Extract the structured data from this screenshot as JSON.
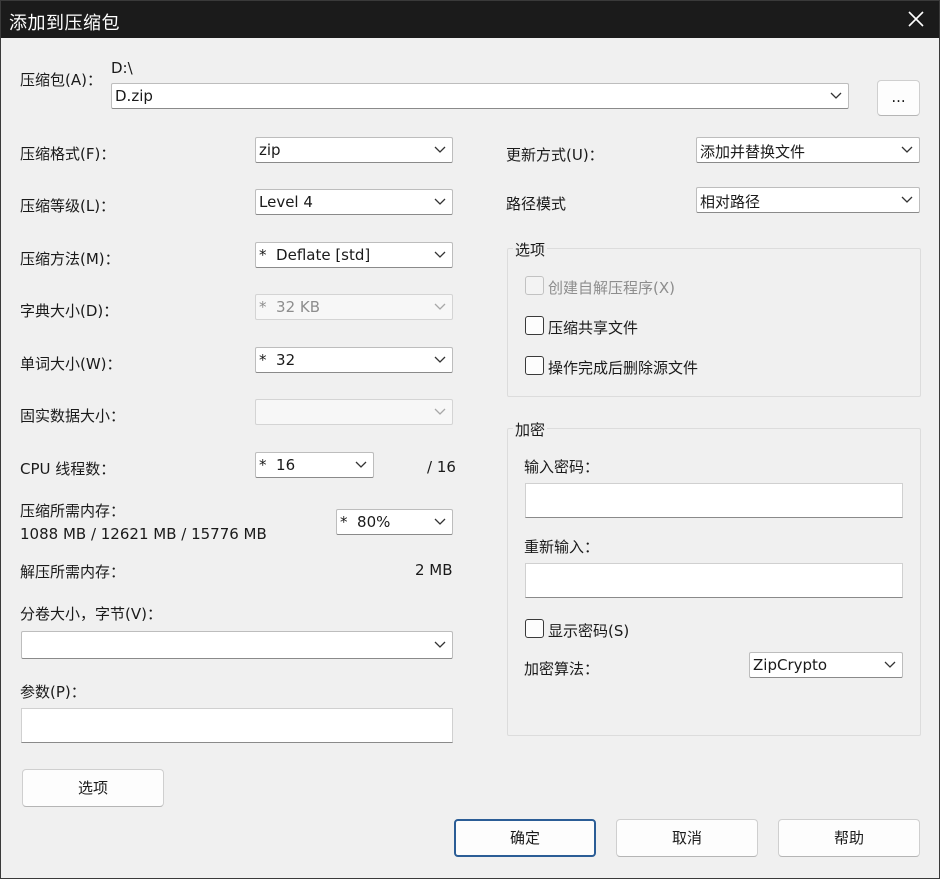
{
  "window": {
    "title": "添加到压缩包",
    "close_icon": "close-icon"
  },
  "archive": {
    "label": "压缩包(A)：",
    "path": "D:\\",
    "filename": "D.zip",
    "browse_label": "..."
  },
  "left": {
    "format": {
      "label": "压缩格式(F)：",
      "value": "zip"
    },
    "level": {
      "label": "压缩等级(L)：",
      "value": "Level 4"
    },
    "method": {
      "label": "压缩方法(M)：",
      "value": "*  Deflate [std]"
    },
    "dictionary": {
      "label": "字典大小(D)：",
      "value": "*  32 KB"
    },
    "word": {
      "label": "单词大小(W)：",
      "value": "*  32"
    },
    "solid": {
      "label": "固实数据大小：",
      "value": ""
    },
    "threads": {
      "label": "CPU 线程数：",
      "value": "*  16",
      "max": "/ 16"
    },
    "memory": {
      "label": "压缩所需内存：",
      "detail": "1088 MB / 12621 MB / 15776 MB",
      "value": "*  80%"
    },
    "decompress_memory": {
      "label": "解压所需内存：",
      "value": "2 MB"
    },
    "split": {
      "label": "分卷大小，字节(V)：",
      "value": ""
    },
    "params": {
      "label": "参数(P)：",
      "value": ""
    },
    "options_button": "选项"
  },
  "right": {
    "update": {
      "label": "更新方式(U)：",
      "value": "添加并替换文件"
    },
    "path_mode": {
      "label": "路径模式",
      "value": "相对路径"
    },
    "options": {
      "legend": "选项",
      "sfx": {
        "label": "创建自解压程序(X)",
        "checked": false,
        "disabled": true
      },
      "shared": {
        "label": "压缩共享文件",
        "checked": false
      },
      "delete": {
        "label": "操作完成后删除源文件",
        "checked": false
      }
    },
    "encryption": {
      "legend": "加密",
      "password_label": "输入密码：",
      "reenter_label": "重新输入：",
      "show_password": {
        "label": "显示密码(S)",
        "checked": false
      },
      "method_label": "加密算法：",
      "method_value": "ZipCrypto"
    }
  },
  "footer": {
    "ok": "确定",
    "cancel": "取消",
    "help": "帮助"
  },
  "colors": {
    "titlebar": "#1b1b1b",
    "dialog": "#f0f0f0",
    "primary_border": "#2b5d96"
  }
}
